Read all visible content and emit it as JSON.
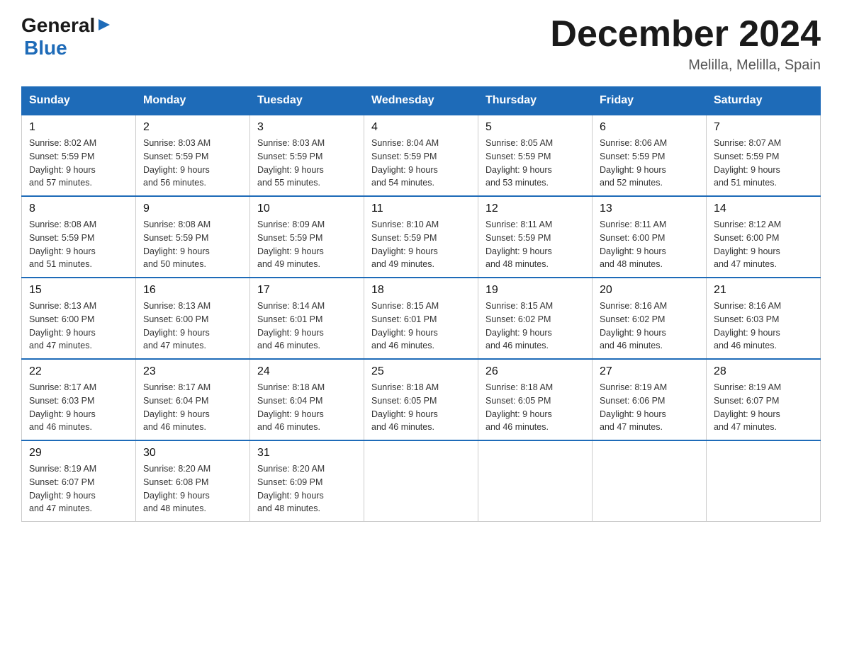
{
  "header": {
    "logo": {
      "general": "General",
      "blue": "Blue"
    },
    "title": "December 2024",
    "location": "Melilla, Melilla, Spain"
  },
  "days_of_week": [
    "Sunday",
    "Monday",
    "Tuesday",
    "Wednesday",
    "Thursday",
    "Friday",
    "Saturday"
  ],
  "weeks": [
    [
      {
        "day": "1",
        "sunrise": "8:02 AM",
        "sunset": "5:59 PM",
        "daylight": "9 hours and 57 minutes."
      },
      {
        "day": "2",
        "sunrise": "8:03 AM",
        "sunset": "5:59 PM",
        "daylight": "9 hours and 56 minutes."
      },
      {
        "day": "3",
        "sunrise": "8:03 AM",
        "sunset": "5:59 PM",
        "daylight": "9 hours and 55 minutes."
      },
      {
        "day": "4",
        "sunrise": "8:04 AM",
        "sunset": "5:59 PM",
        "daylight": "9 hours and 54 minutes."
      },
      {
        "day": "5",
        "sunrise": "8:05 AM",
        "sunset": "5:59 PM",
        "daylight": "9 hours and 53 minutes."
      },
      {
        "day": "6",
        "sunrise": "8:06 AM",
        "sunset": "5:59 PM",
        "daylight": "9 hours and 52 minutes."
      },
      {
        "day": "7",
        "sunrise": "8:07 AM",
        "sunset": "5:59 PM",
        "daylight": "9 hours and 51 minutes."
      }
    ],
    [
      {
        "day": "8",
        "sunrise": "8:08 AM",
        "sunset": "5:59 PM",
        "daylight": "9 hours and 51 minutes."
      },
      {
        "day": "9",
        "sunrise": "8:08 AM",
        "sunset": "5:59 PM",
        "daylight": "9 hours and 50 minutes."
      },
      {
        "day": "10",
        "sunrise": "8:09 AM",
        "sunset": "5:59 PM",
        "daylight": "9 hours and 49 minutes."
      },
      {
        "day": "11",
        "sunrise": "8:10 AM",
        "sunset": "5:59 PM",
        "daylight": "9 hours and 49 minutes."
      },
      {
        "day": "12",
        "sunrise": "8:11 AM",
        "sunset": "5:59 PM",
        "daylight": "9 hours and 48 minutes."
      },
      {
        "day": "13",
        "sunrise": "8:11 AM",
        "sunset": "6:00 PM",
        "daylight": "9 hours and 48 minutes."
      },
      {
        "day": "14",
        "sunrise": "8:12 AM",
        "sunset": "6:00 PM",
        "daylight": "9 hours and 47 minutes."
      }
    ],
    [
      {
        "day": "15",
        "sunrise": "8:13 AM",
        "sunset": "6:00 PM",
        "daylight": "9 hours and 47 minutes."
      },
      {
        "day": "16",
        "sunrise": "8:13 AM",
        "sunset": "6:00 PM",
        "daylight": "9 hours and 47 minutes."
      },
      {
        "day": "17",
        "sunrise": "8:14 AM",
        "sunset": "6:01 PM",
        "daylight": "9 hours and 46 minutes."
      },
      {
        "day": "18",
        "sunrise": "8:15 AM",
        "sunset": "6:01 PM",
        "daylight": "9 hours and 46 minutes."
      },
      {
        "day": "19",
        "sunrise": "8:15 AM",
        "sunset": "6:02 PM",
        "daylight": "9 hours and 46 minutes."
      },
      {
        "day": "20",
        "sunrise": "8:16 AM",
        "sunset": "6:02 PM",
        "daylight": "9 hours and 46 minutes."
      },
      {
        "day": "21",
        "sunrise": "8:16 AM",
        "sunset": "6:03 PM",
        "daylight": "9 hours and 46 minutes."
      }
    ],
    [
      {
        "day": "22",
        "sunrise": "8:17 AM",
        "sunset": "6:03 PM",
        "daylight": "9 hours and 46 minutes."
      },
      {
        "day": "23",
        "sunrise": "8:17 AM",
        "sunset": "6:04 PM",
        "daylight": "9 hours and 46 minutes."
      },
      {
        "day": "24",
        "sunrise": "8:18 AM",
        "sunset": "6:04 PM",
        "daylight": "9 hours and 46 minutes."
      },
      {
        "day": "25",
        "sunrise": "8:18 AM",
        "sunset": "6:05 PM",
        "daylight": "9 hours and 46 minutes."
      },
      {
        "day": "26",
        "sunrise": "8:18 AM",
        "sunset": "6:05 PM",
        "daylight": "9 hours and 46 minutes."
      },
      {
        "day": "27",
        "sunrise": "8:19 AM",
        "sunset": "6:06 PM",
        "daylight": "9 hours and 47 minutes."
      },
      {
        "day": "28",
        "sunrise": "8:19 AM",
        "sunset": "6:07 PM",
        "daylight": "9 hours and 47 minutes."
      }
    ],
    [
      {
        "day": "29",
        "sunrise": "8:19 AM",
        "sunset": "6:07 PM",
        "daylight": "9 hours and 47 minutes."
      },
      {
        "day": "30",
        "sunrise": "8:20 AM",
        "sunset": "6:08 PM",
        "daylight": "9 hours and 48 minutes."
      },
      {
        "day": "31",
        "sunrise": "8:20 AM",
        "sunset": "6:09 PM",
        "daylight": "9 hours and 48 minutes."
      },
      null,
      null,
      null,
      null
    ]
  ],
  "labels": {
    "sunrise": "Sunrise:",
    "sunset": "Sunset:",
    "daylight": "Daylight:"
  }
}
